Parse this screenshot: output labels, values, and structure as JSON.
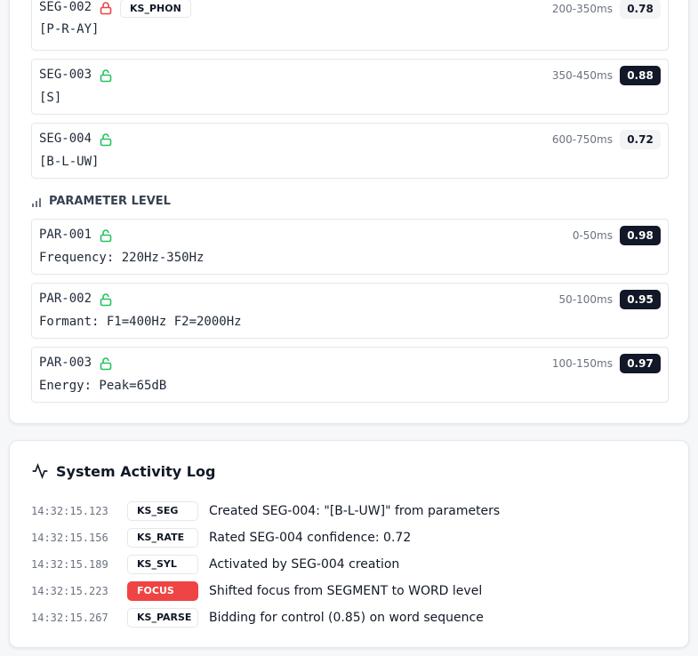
{
  "segment_items": [
    {
      "id": "SEG-002",
      "locked": true,
      "ks": "KS_PHON",
      "value": "[P-R-AY]",
      "time": "200-350ms",
      "confidence": "0.78",
      "conf_style": "light"
    },
    {
      "id": "SEG-003",
      "locked": false,
      "value": "[S]",
      "time": "350-450ms",
      "confidence": "0.88",
      "conf_style": "dark"
    },
    {
      "id": "SEG-004",
      "locked": false,
      "value": "[B-L-UW]",
      "time": "600-750ms",
      "confidence": "0.72",
      "conf_style": "light"
    }
  ],
  "parameter_heading": "PARAMETER LEVEL",
  "parameter_items": [
    {
      "id": "PAR-001",
      "locked": false,
      "value": "Frequency: 220Hz-350Hz",
      "time": "0-50ms",
      "confidence": "0.98",
      "conf_style": "dark"
    },
    {
      "id": "PAR-002",
      "locked": false,
      "value": "Formant: F1=400Hz F2=2000Hz",
      "time": "50-100ms",
      "confidence": "0.95",
      "conf_style": "dark"
    },
    {
      "id": "PAR-003",
      "locked": false,
      "value": "Energy: Peak=65dB",
      "time": "100-150ms",
      "confidence": "0.97",
      "conf_style": "dark"
    }
  ],
  "log": {
    "title": "System Activity Log",
    "entries": [
      {
        "time": "14:32:15.123",
        "source": "KS_SEG",
        "message": "Created SEG-004: \"[B-L-UW]\" from parameters",
        "highlight": false
      },
      {
        "time": "14:32:15.156",
        "source": "KS_RATE",
        "message": "Rated SEG-004 confidence: 0.72",
        "highlight": false
      },
      {
        "time": "14:32:15.189",
        "source": "KS_SYL",
        "message": "Activated by SEG-004 creation",
        "highlight": false
      },
      {
        "time": "14:32:15.223",
        "source": "FOCUS",
        "message": "Shifted focus from SEGMENT to WORD level",
        "highlight": true
      },
      {
        "time": "14:32:15.267",
        "source": "KS_PARSE",
        "message": "Bidding for control (0.85) on word sequence",
        "highlight": false
      }
    ]
  },
  "colors": {
    "locked": "#ef4444",
    "unlocked": "#22c55e",
    "focus": "#ef4444"
  }
}
